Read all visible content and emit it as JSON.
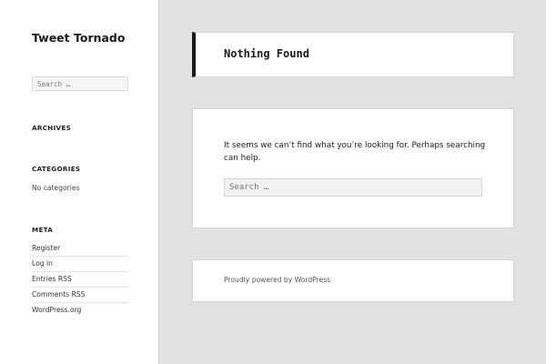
{
  "site": {
    "title": "Tweet Tornado"
  },
  "sidebar": {
    "search_placeholder": "Search …",
    "archives_title": "ARCHIVES",
    "categories_title": "CATEGORIES",
    "no_categories": "No categories",
    "meta_title": "META",
    "meta_links": [
      "Register",
      "Log in",
      "Entries RSS",
      "Comments RSS",
      "WordPress.org"
    ]
  },
  "main": {
    "page_title": "Nothing Found",
    "message": "It seems we can’t find what you’re looking for. Perhaps searching can help.",
    "search_placeholder": "Search …"
  },
  "footer": {
    "credit": "Proudly powered by WordPress"
  }
}
